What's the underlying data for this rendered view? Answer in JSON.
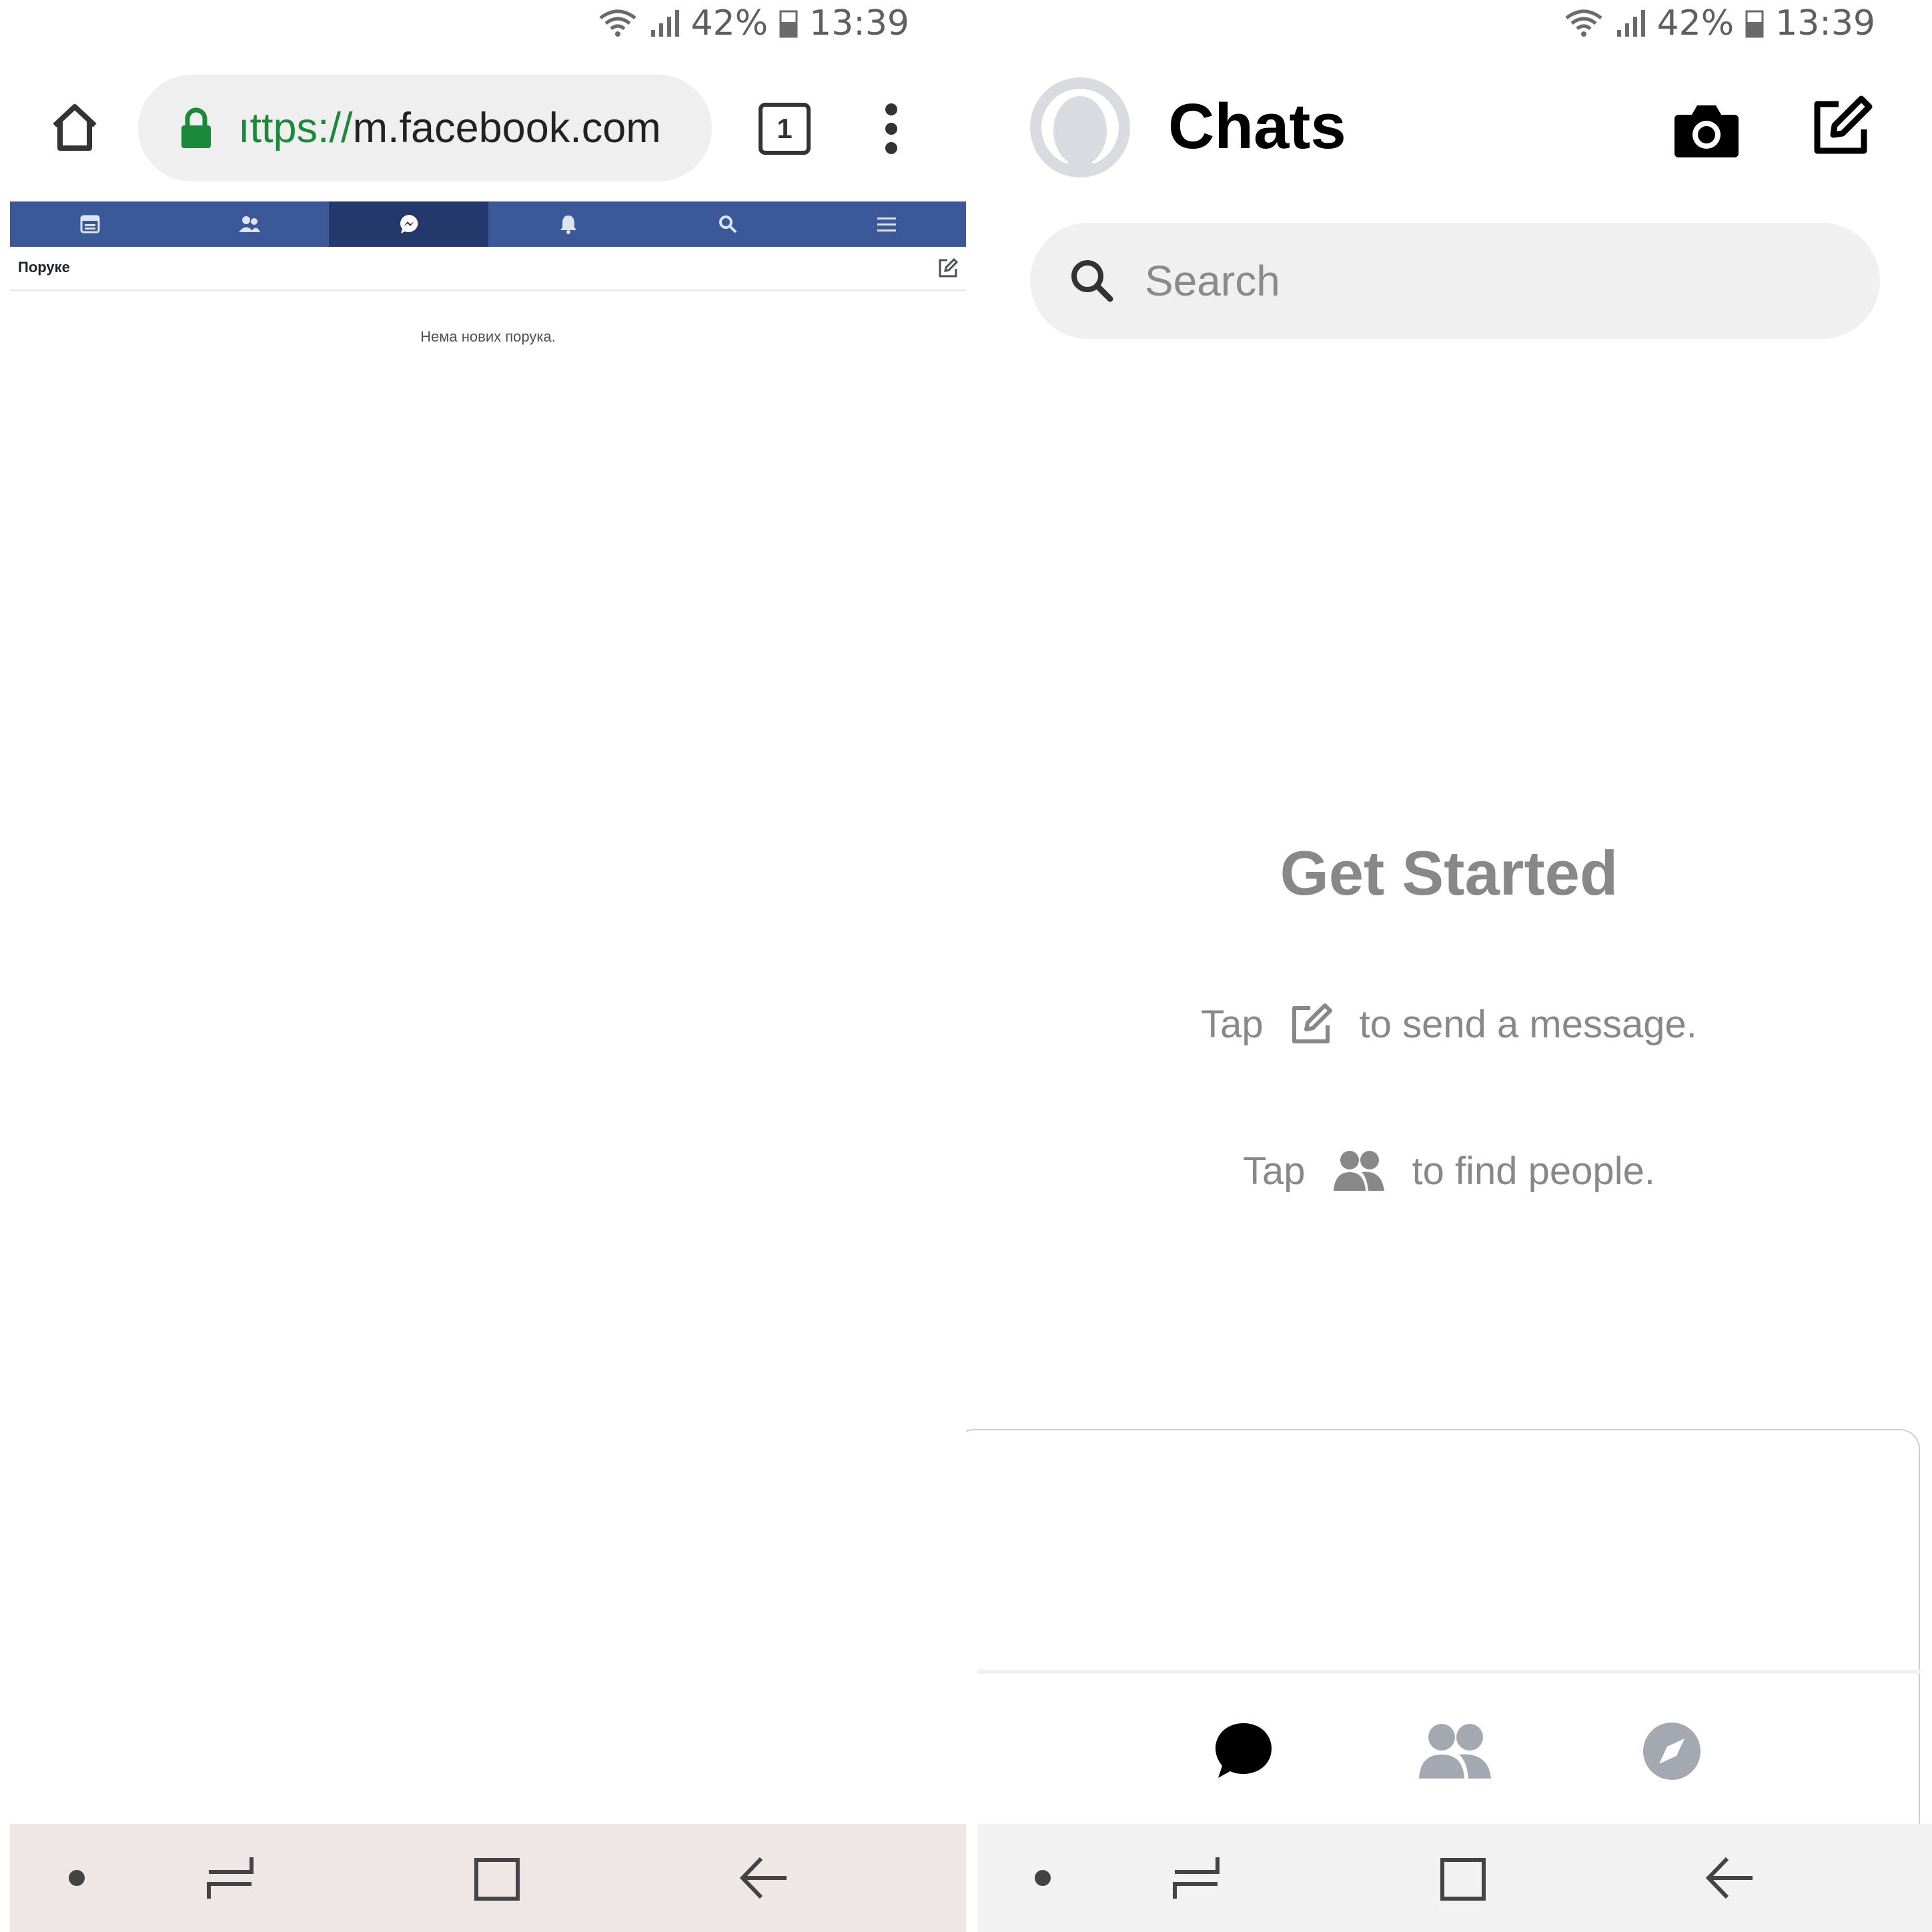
{
  "status_bar": {
    "battery": "42%",
    "time": "13:39"
  },
  "browser": {
    "url_scheme": "ıttps://",
    "url_host": "m.facebook.com",
    "tab_count": "1",
    "nav_items": [
      "news-feed",
      "friends",
      "messages",
      "notifications",
      "search",
      "menu"
    ],
    "active_nav": "messages",
    "page_title": "Поруке",
    "empty_text": "Нема нових порука."
  },
  "messenger": {
    "title": "Chats",
    "search_placeholder": "Search",
    "get_started": "Get Started",
    "tip1_prefix": "Tap",
    "tip1_suffix": "to send a message.",
    "tip2_prefix": "Tap",
    "tip2_suffix": "to find people.",
    "tabs": [
      "chats",
      "people",
      "discover"
    ]
  },
  "colors": {
    "facebook_blue": "#3b5998",
    "facebook_active": "#23386b",
    "secure_green": "#1a8a3a",
    "muted_text": "#888888"
  }
}
